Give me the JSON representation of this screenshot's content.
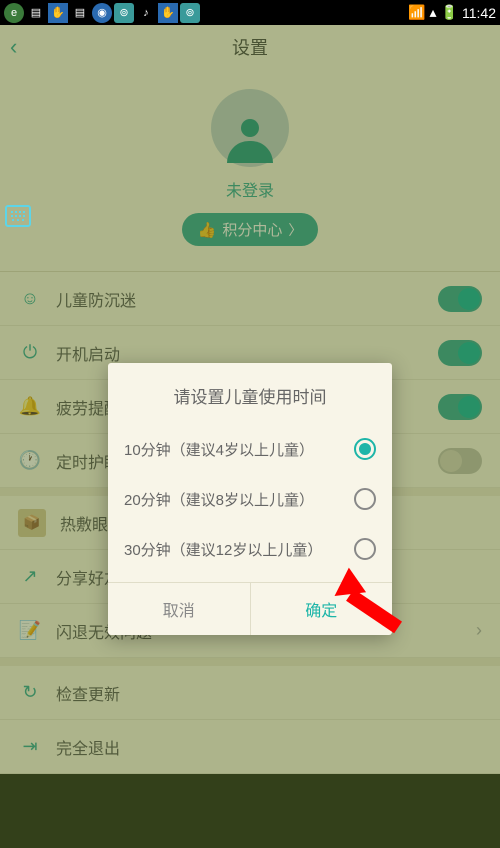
{
  "statusbar": {
    "time": "11:42"
  },
  "header": {
    "title": "设置"
  },
  "profile": {
    "status": "未登录",
    "points_label": "积分中心"
  },
  "settings": [
    {
      "label": "儿童防沉迷",
      "toggle": true
    },
    {
      "label": "开机启动",
      "toggle": true
    },
    {
      "label": "疲劳提醒",
      "toggle": true
    },
    {
      "label": "定时护眼",
      "toggle": false
    }
  ],
  "extras": [
    {
      "label": "热敷眼罩"
    },
    {
      "label": "分享好友"
    },
    {
      "label": "闪退无效问题"
    }
  ],
  "footer": [
    {
      "label": "检查更新"
    },
    {
      "label": "完全退出"
    }
  ],
  "dialog": {
    "title": "请设置儿童使用时间",
    "options": [
      {
        "label": "10分钟（建议4岁以上儿童）",
        "selected": true
      },
      {
        "label": "20分钟（建议8岁以上儿童）",
        "selected": false
      },
      {
        "label": "30分钟（建议12岁以上儿童）",
        "selected": false
      }
    ],
    "cancel": "取消",
    "confirm": "确定"
  }
}
